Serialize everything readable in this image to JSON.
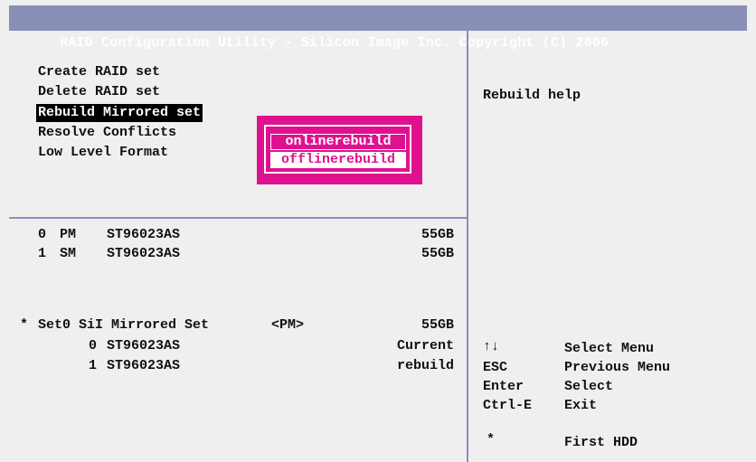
{
  "window": {
    "title": "RAID Configuration Utility - Silicon Image Inc. Copyright (C) 2006"
  },
  "menu": {
    "items": [
      {
        "label": "Create RAID set"
      },
      {
        "label": "Delete RAID set"
      },
      {
        "label": "Rebuild Mirrored set",
        "selected": true
      },
      {
        "label": "Resolve Conflicts"
      },
      {
        "label": "Low Level Format"
      }
    ]
  },
  "popup": {
    "options": [
      {
        "label": "onlinerebuild"
      },
      {
        "label": "offlinerebuild",
        "selected": true
      }
    ],
    "color": "#e0118f"
  },
  "help": {
    "title": "Rebuild help"
  },
  "drives": [
    {
      "port": "0",
      "role": "PM",
      "model": "ST96023AS",
      "size": "55GB"
    },
    {
      "port": "1",
      "role": "SM",
      "model": "ST96023AS",
      "size": "55GB"
    }
  ],
  "raid_set": {
    "marker": "*",
    "name": "Set0 SiI Mirrored Set",
    "tag": "<PM>",
    "size": "55GB",
    "members": [
      {
        "index": "0",
        "model": "ST96023AS",
        "status": "Current"
      },
      {
        "index": "1",
        "model": "ST96023AS",
        "status": "rebuild"
      }
    ]
  },
  "keys": [
    {
      "key": "↑↓",
      "action": "Select Menu"
    },
    {
      "key": "ESC",
      "action": "Previous Menu"
    },
    {
      "key": "Enter",
      "action": "Select"
    },
    {
      "key": "Ctrl-E",
      "action": "Exit"
    },
    {
      "key": "*",
      "action": "First HDD"
    }
  ],
  "colors": {
    "titlebar": "#8a8fb8",
    "background": "#efefef",
    "selection": "#000000"
  }
}
